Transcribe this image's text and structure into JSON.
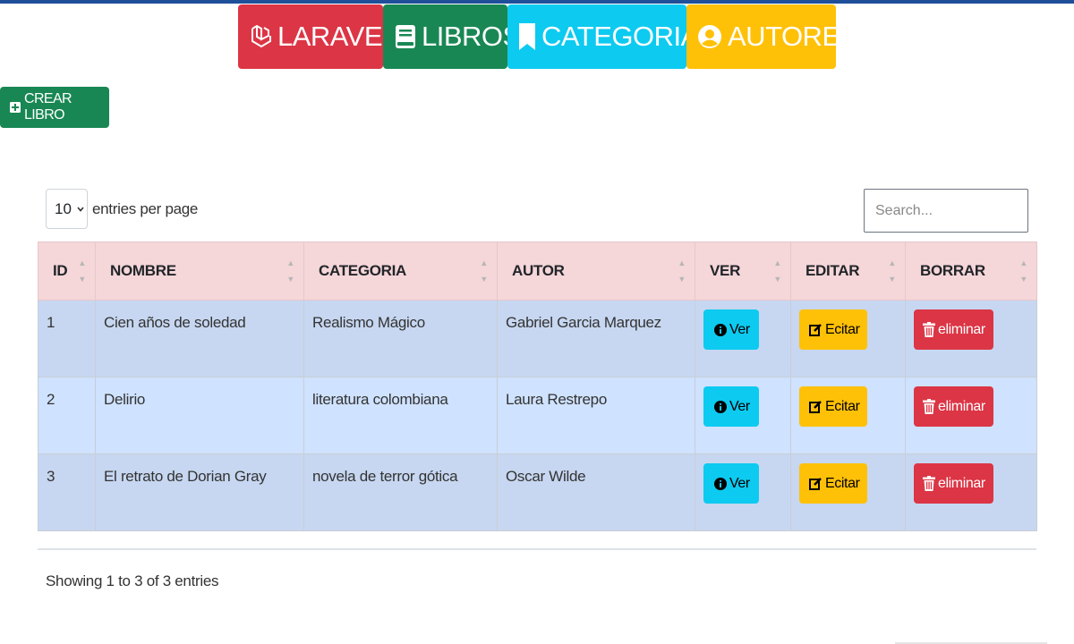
{
  "nav": {
    "items": [
      {
        "label": "LARAVEL",
        "icon": "laravel-icon",
        "color": "#dc3545"
      },
      {
        "label": "LIBROS",
        "icon": "book-icon",
        "color": "#198754"
      },
      {
        "label": "CATEGORIAS",
        "icon": "bookmark-icon",
        "color": "#0dcaf0"
      },
      {
        "label": "AUTORES",
        "icon": "user-circle-icon",
        "color": "#ffc107"
      }
    ]
  },
  "actions": {
    "create_label": "CREAR LIBRO"
  },
  "datatable": {
    "per_page_value": "10",
    "per_page_label": "entries per page",
    "search_placeholder": "Search...",
    "info": "Showing 1 to 3 of 3 entries"
  },
  "table": {
    "headers": [
      "ID",
      "NOMBRE",
      "CATEGORIA",
      "AUTOR",
      "VER",
      "EDITAR",
      "BORRAR"
    ],
    "rows": [
      {
        "id": "1",
        "nombre": "Cien años de soledad",
        "categoria": "Realismo Mágico",
        "autor": "Gabriel Garcia Marquez",
        "ver": "Ver",
        "editar": "Ecitar",
        "borrar": "eliminar"
      },
      {
        "id": "2",
        "nombre": "Delirio",
        "categoria": "literatura colombiana",
        "autor": "Laura Restrepo",
        "ver": "Ver",
        "editar": "Ecitar",
        "borrar": "eliminar"
      },
      {
        "id": "3",
        "nombre": "El retrato de Dorian Gray",
        "categoria": "novela de terror gótica",
        "autor": "Oscar Wilde",
        "ver": "Ver",
        "editar": "Ecitar",
        "borrar": "eliminar"
      }
    ]
  },
  "colors": {
    "header_bg": "#f5d6d9",
    "row_odd": "#c7d7f1",
    "row_even": "#cfe2ff",
    "success": "#198754",
    "danger": "#dc3545",
    "info": "#0dcaf0",
    "warning": "#ffc107"
  }
}
